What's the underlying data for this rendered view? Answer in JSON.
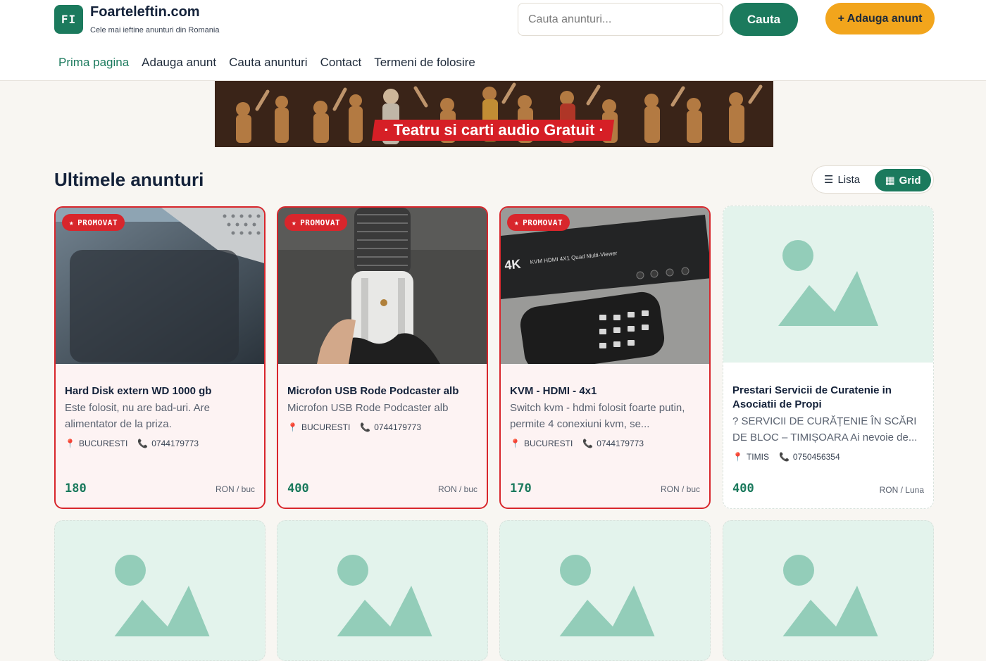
{
  "header": {
    "logo_text": "FI",
    "site_name": "Foarteleftin.com",
    "tagline": "Cele mai ieftine anunturi din Romania",
    "search_placeholder": "Cauta anunturi...",
    "search_button": "Cauta",
    "add_button": "+ Adauga anunt"
  },
  "nav": {
    "items": [
      {
        "label": "Prima pagina",
        "active": true
      },
      {
        "label": "Adauga anunt",
        "active": false
      },
      {
        "label": "Cauta anunturi",
        "active": false
      },
      {
        "label": "Contact",
        "active": false
      },
      {
        "label": "Termeni de folosire",
        "active": false
      }
    ]
  },
  "banner": {
    "text": "· Teatru si carti audio Gratuit ·"
  },
  "section": {
    "title": "Ultimele anunturi",
    "view_lista": "Lista",
    "view_grid": "Grid",
    "active_view": "Grid"
  },
  "listings": [
    {
      "promoted": true,
      "badge": "PROMOVAT",
      "title": "Hard Disk extern WD 1000 gb",
      "description": "Este folosit, nu are bad-uri. Are alimentator de la priza.",
      "location": "BUCURESTI",
      "phone": "0744179773",
      "price": "180",
      "unit": "RON / buc",
      "image": "hard-disk-photo"
    },
    {
      "promoted": true,
      "badge": "PROMOVAT",
      "title": "Microfon USB Rode Podcaster alb",
      "description": "Microfon USB Rode Podcaster alb",
      "location": "BUCURESTI",
      "phone": "0744179773",
      "price": "400",
      "unit": "RON / buc",
      "image": "microphone-photo"
    },
    {
      "promoted": true,
      "badge": "PROMOVAT",
      "title": "KVM - HDMI - 4x1",
      "description": "Switch kvm - hdmi folosit foarte putin, permite 4 conexiuni kvm, se...",
      "location": "BUCURESTI",
      "phone": "0744179773",
      "price": "170",
      "unit": "RON / buc",
      "image": "kvm-switch-photo",
      "image_label": "KVM HDMI 4X1 Quad Multi-Viewer"
    },
    {
      "promoted": false,
      "title": "Prestari Servicii de Curatenie in Asociatii de Propi",
      "description": "? SERVICII DE CURĂȚENIE ÎN SCĂRI DE BLOC – TIMIȘOARA Ai nevoie de...",
      "location": "TIMIS",
      "phone": "0750456354",
      "price": "400",
      "unit": "RON / Luna",
      "image": "image-placeholder-icon"
    }
  ],
  "colors": {
    "brand_green": "#1b7a5d",
    "accent_orange": "#f2a51c",
    "promo_red": "#d8262c",
    "placeholder_bg": "#e3f3ec",
    "placeholder_icon": "#93cdb9"
  }
}
